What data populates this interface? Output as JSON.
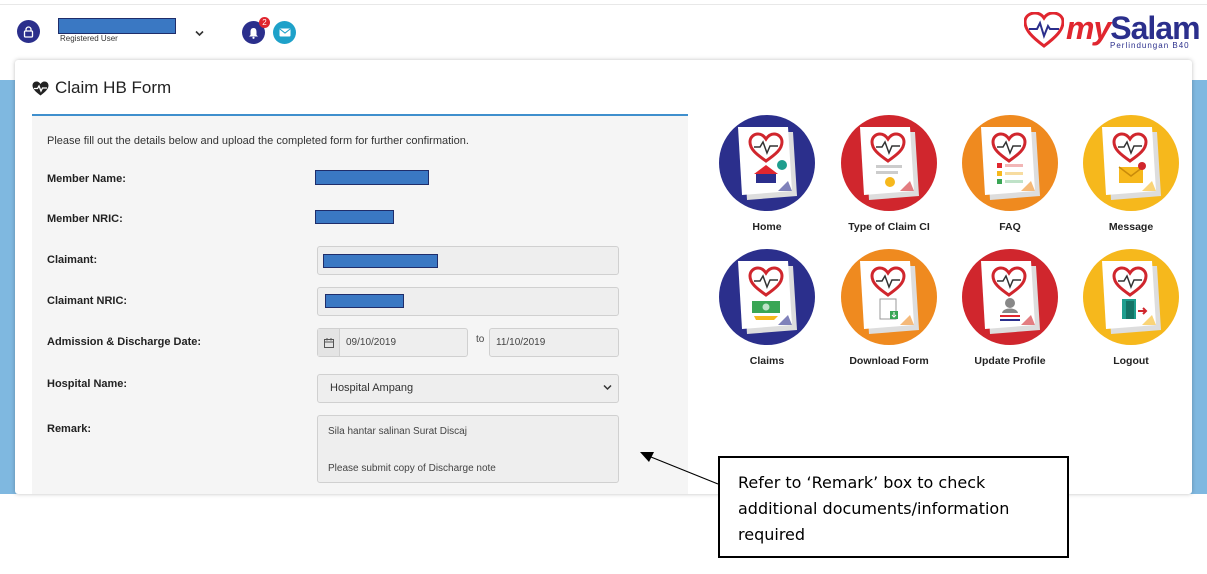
{
  "header": {
    "user_role": "Registered User",
    "notification_count": "2",
    "logo_my": "my",
    "logo_salam": "Salam",
    "logo_sub": "Perlindungan B40"
  },
  "page": {
    "title": "Claim HB Form"
  },
  "form": {
    "intro": "Please fill out the details below and upload the completed form for further confirmation.",
    "member_name_label": "Member Name:",
    "member_nric_label": "Member NRIC:",
    "claimant_label": "Claimant:",
    "claimant_nric_label": "Claimant NRIC:",
    "admission_label": "Admission & Discharge Date:",
    "admission_date": "09/10/2019",
    "to_label": "to",
    "discharge_date": "11/10/2019",
    "hospital_label": "Hospital Name:",
    "hospital_value": "Hospital Ampang",
    "remark_label": "Remark:",
    "remark_line1": "Sila hantar salinan Surat Discaj",
    "remark_line2": "Please submit copy of Discharge note"
  },
  "tiles": [
    {
      "label": "Home",
      "color": "#2b2f8c",
      "icon": "home-icon"
    },
    {
      "label": "Type of Claim CI",
      "color": "#d0262d",
      "icon": "certificate-icon"
    },
    {
      "label": "FAQ",
      "color": "#ef8a1f",
      "icon": "faq-list-icon"
    },
    {
      "label": "Message",
      "color": "#f6b81c",
      "icon": "message-icon"
    },
    {
      "label": "Claims",
      "color": "#2b2f8c",
      "icon": "money-icon"
    },
    {
      "label": "Download Form",
      "color": "#ef8a1f",
      "icon": "download-icon"
    },
    {
      "label": "Update Profile",
      "color": "#d0262d",
      "icon": "profile-icon"
    },
    {
      "label": "Logout",
      "color": "#f6b81c",
      "icon": "logout-icon"
    }
  ],
  "annotation": {
    "line1": "Refer to ‘Remark’ box to check",
    "line2": "additional documents/information",
    "line3": "required"
  },
  "colors": {
    "primary": "#2b2f8c",
    "accent_red": "#e0262f",
    "accent_blue": "#3f8fcd"
  }
}
